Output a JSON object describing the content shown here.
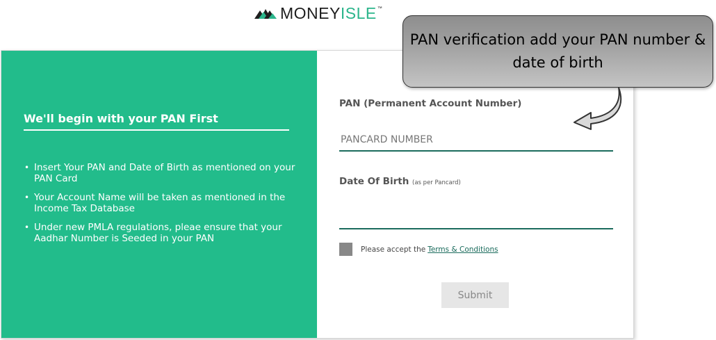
{
  "logo": {
    "word_money": "MONEY",
    "word_isle": "ISLE",
    "trademark": "™",
    "icon": "mountain-logo-icon"
  },
  "left": {
    "heading": "We'll begin with your PAN First",
    "bullets": [
      "Insert Your PAN and Date of Birth as mentioned on your PAN Card",
      "Your Account Name will be taken as mentioned in the Income Tax Database",
      "Under new PMLA regulations, pleae ensure that your Aadhar Number is Seeded in your PAN"
    ]
  },
  "form": {
    "pan_label": "PAN (Permanent Account Number)",
    "pan_placeholder": "PANCARD NUMBER",
    "dob_label": "Date Of Birth",
    "dob_note": "(as per Pancard)",
    "accept_text": "Please accept the",
    "terms_link": "Terms & Conditions",
    "submit_label": "Submit"
  },
  "callout": {
    "text": "PAN verification add your PAN number & date of birth"
  },
  "colors": {
    "brand_green": "#22bc8b",
    "logo_green": "#2bb58b",
    "field_underline": "#1a6b5c",
    "checkbox_gray": "#888888",
    "submit_bg": "#e6e6e6"
  }
}
